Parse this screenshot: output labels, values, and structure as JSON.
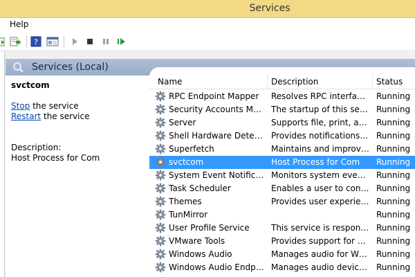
{
  "window": {
    "title": "Services"
  },
  "menu": {
    "help_label": "Help"
  },
  "toolbar": {
    "buttons": [
      "export-list-icon",
      "help-icon",
      "properties-icon",
      "start-service-icon",
      "stop-service-icon",
      "pause-service-icon",
      "restart-service-icon"
    ]
  },
  "pane": {
    "title": "Services (Local)"
  },
  "detail": {
    "service_name": "svctcom",
    "stop_link": "Stop",
    "stop_suffix": " the service",
    "restart_link": "Restart",
    "restart_suffix": " the service",
    "description_label": "Description:",
    "description_text": "Host Process for Com"
  },
  "columns": {
    "name": "Name",
    "description": "Description",
    "status": "Status"
  },
  "rows": [
    {
      "name": "RPC Endpoint Mapper",
      "description": "Resolves RPC interfaces i...",
      "status": "Running"
    },
    {
      "name": "Security Accounts Mana...",
      "description": "The startup of this servic...",
      "status": "Running"
    },
    {
      "name": "Server",
      "description": "Supports file, print, and ...",
      "status": "Running"
    },
    {
      "name": "Shell Hardware Detection",
      "description": "Provides notifications fo...",
      "status": "Running"
    },
    {
      "name": "Superfetch",
      "description": "Maintains and improves ...",
      "status": "Running"
    },
    {
      "name": "svctcom",
      "description": "Host Process for Com",
      "status": "Running",
      "selected": true
    },
    {
      "name": "System Event Notificatio...",
      "description": "Monitors system events ...",
      "status": "Running"
    },
    {
      "name": "Task Scheduler",
      "description": "Enables a user to config...",
      "status": "Running"
    },
    {
      "name": "Themes",
      "description": "Provides user experience...",
      "status": "Running"
    },
    {
      "name": "TunMirror",
      "description": "",
      "status": "Running"
    },
    {
      "name": "User Profile Service",
      "description": "This service is responsibl...",
      "status": "Running"
    },
    {
      "name": "VMware Tools",
      "description": "Provides support for syn...",
      "status": "Running"
    },
    {
      "name": "Windows Audio",
      "description": "Manages audio for Wind...",
      "status": "Running"
    },
    {
      "name": "Windows Audio Endpoin...",
      "description": "Manages audio devices f...",
      "status": "Running"
    }
  ],
  "colors": {
    "selection": "#3399ff",
    "titlebar": "#f4d985",
    "link": "#0645ad"
  }
}
